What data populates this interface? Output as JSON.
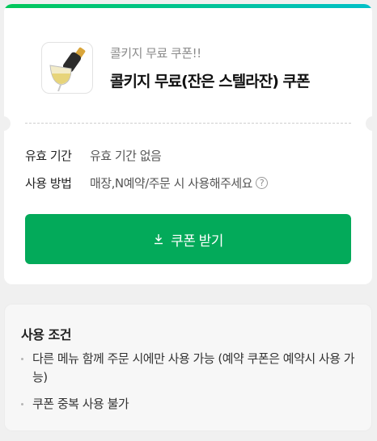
{
  "coupon": {
    "subtitle": "콜키지 무료 쿠폰!!",
    "title": "콜키지 무료(잔은 스텔라잔) 쿠폰",
    "image_icon": "wine-pouring-icon"
  },
  "info": {
    "validity_label": "유효 기간",
    "validity_value": "유효 기간 없음",
    "usage_label": "사용 방법",
    "usage_value": "매장,N예약/주문 시 사용해주세요",
    "help_symbol": "?"
  },
  "button": {
    "label": "쿠폰 받기",
    "icon": "download-icon"
  },
  "conditions": {
    "title": "사용 조건",
    "items": [
      "다른 메뉴 함께 주문 시에만 사용 가능 (예약 쿠폰은 예약시 사용 가능)",
      "쿠폰 중복 사용 불가"
    ]
  },
  "colors": {
    "accent": "#03aa5a",
    "top_bar_start": "#03c75a",
    "top_bar_end": "#00c0c8"
  }
}
